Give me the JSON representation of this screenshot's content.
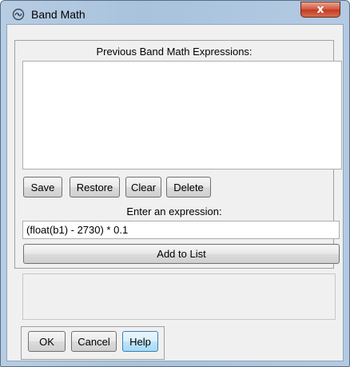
{
  "window": {
    "title": "Band Math",
    "close_label": "x",
    "icon": "band-math-app-icon"
  },
  "previous": {
    "label": "Previous Band Math Expressions:",
    "items": []
  },
  "list_buttons": {
    "save": "Save",
    "restore": "Restore",
    "clear": "Clear",
    "delete": "Delete"
  },
  "expression": {
    "label": "Enter an expression:",
    "value": "(float(b1) - 2730) * 0.1"
  },
  "add_to_list": "Add to List",
  "dialog_buttons": {
    "ok": "OK",
    "cancel": "Cancel",
    "help": "Help"
  },
  "colors": {
    "close_button": "#c03a22",
    "focus_border": "#3c7fb1"
  }
}
